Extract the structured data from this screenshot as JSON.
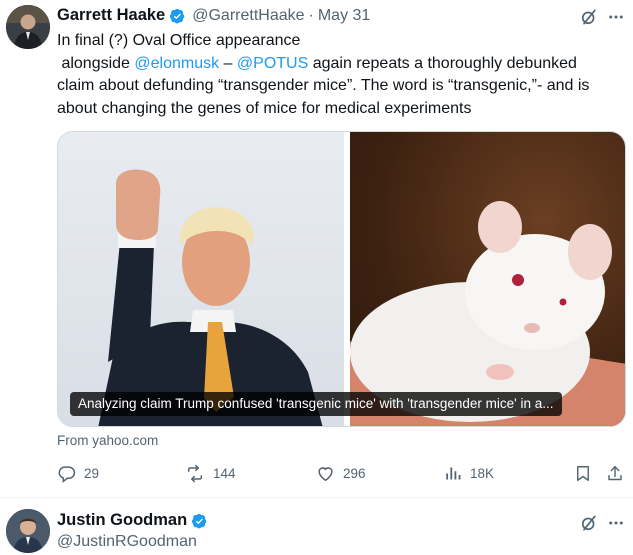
{
  "tweet": {
    "author": {
      "display_name": "Garrett Haake",
      "handle": "@GarrettHaake",
      "verified": true
    },
    "separator": "·",
    "date": "May 31",
    "text": {
      "line1": "In final (?) Oval Office appearance",
      "alongside_prefix": " alongside ",
      "mention1": "@elonmusk",
      "dash": " – ",
      "mention2": "@POTUS",
      "body": " again repeats a thoroughly debunked claim about defunding “transgender mice”. The word is “transgenic,”- and is about changing the genes of mice for medical experiments"
    },
    "card": {
      "caption": "Analyzing claim Trump confused 'transgenic mice' with 'transgender mice' in a...",
      "source": "From yahoo.com"
    },
    "actions": {
      "replies": "29",
      "reposts": "144",
      "likes": "296",
      "views": "18K"
    }
  },
  "next_tweet": {
    "author": {
      "display_name": "Justin Goodman",
      "handle": "@JustinRGoodman",
      "verified": true
    }
  },
  "icons": {
    "verified": "verified-badge-icon",
    "grok": "grok-icon",
    "more": "more-icon",
    "reply": "reply-icon",
    "repost": "repost-icon",
    "like": "like-icon",
    "views": "views-icon",
    "bookmark": "bookmark-icon",
    "share": "share-icon"
  },
  "colors": {
    "accent": "#1d9bf0",
    "text": "#0f1419",
    "muted": "#536471",
    "border": "#cfd9de"
  }
}
